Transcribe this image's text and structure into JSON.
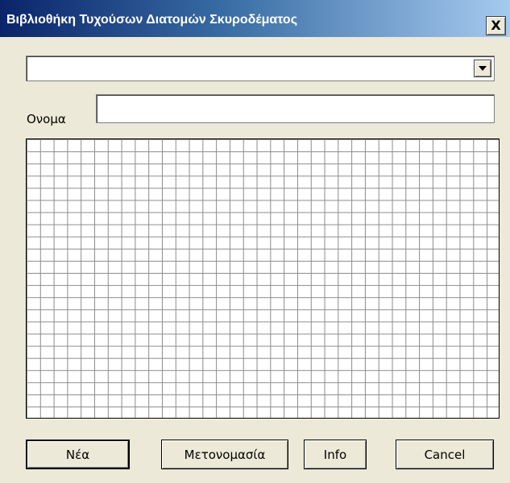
{
  "window": {
    "title": "Βιβλιοθήκη Τυχούσων Διατομών Σκυροδέματος",
    "close_label": "X"
  },
  "section_dropdown": {
    "selected_value": ""
  },
  "name_field": {
    "label": "Ονομα",
    "value": ""
  },
  "grid": {
    "columns": 35,
    "rows": 23
  },
  "buttons": {
    "new_label": "Νέα",
    "rename_label": "Μετονομασία",
    "info_label": "Info",
    "cancel_label": "Cancel"
  },
  "colors": {
    "face": "#ece9d8",
    "title_start": "#0a246a",
    "title_end": "#a6caf0",
    "grid_line": "#8a8a8a"
  }
}
